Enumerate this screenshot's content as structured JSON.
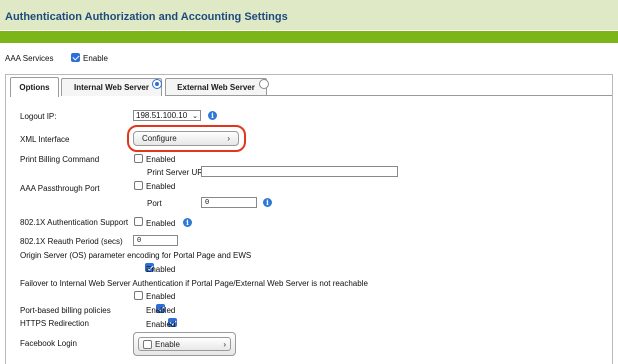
{
  "header": {
    "title": "Authentication Authorization and Accounting Settings"
  },
  "aaa": {
    "label": "AAA Services",
    "enable_label": "Enable",
    "enabled": true
  },
  "tabs": [
    {
      "label": "Options"
    },
    {
      "label": "Internal Web Server",
      "radio_selected": true
    },
    {
      "label": "External Web Server",
      "radio_selected": false
    }
  ],
  "fields": {
    "logout_ip": {
      "label": "Logout IP:",
      "value": "198.51.100.10"
    },
    "xml_interface": {
      "label": "XML Interface",
      "button": "Configure",
      "chevron": "›"
    },
    "print_billing": {
      "label": "Print Billing Command",
      "enabled_label": "Enabled",
      "url_label": "Print Server URL",
      "url_value": ""
    },
    "passthrough": {
      "label": "AAA Passthrough Port",
      "enabled_label": "Enabled",
      "port_label": "Port",
      "port_value": "0"
    },
    "dot1x_auth": {
      "label": "802.1X Authentication Support",
      "enabled_label": "Enabled"
    },
    "dot1x_reauth": {
      "label": "802.1X Reauth Period (secs)",
      "value": "0"
    },
    "origin_server": {
      "label": "Origin Server (OS) parameter encoding for Portal Page and EWS",
      "enabled_label": "Enabled"
    },
    "failover": {
      "label": "Failover to Internal Web Server Authentication if Portal Page/External Web Server is not reachable",
      "enabled_label": "Enabled"
    },
    "port_billing": {
      "label": "Port-based billing policies",
      "enabled_label": "Enabled"
    },
    "https_redirect": {
      "label": "HTTPS Redirection",
      "enabled_label": "Enabled"
    },
    "facebook": {
      "label": "Facebook Login",
      "enable_label": "Enable",
      "chevron": "›"
    }
  },
  "icons": {
    "info": "info-icon",
    "chevron": "chevron-right-icon",
    "dropdown": "chevron-down-icon"
  },
  "colors": {
    "header_bg": "#dfe9c6",
    "title": "#1f4a7c",
    "stripe": "#7cb518",
    "highlight": "#e0371c",
    "accent": "#2d6fd6"
  }
}
